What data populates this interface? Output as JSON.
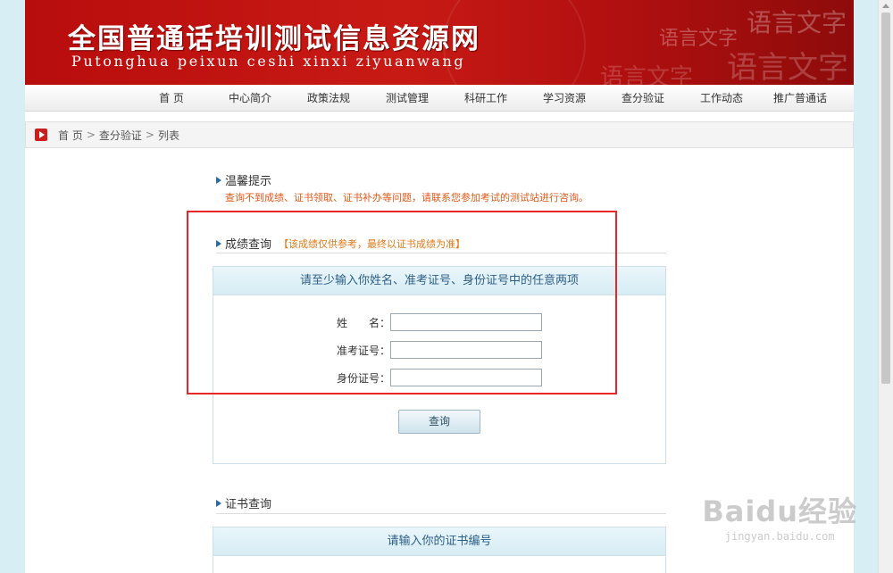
{
  "site": {
    "title_cn": "全国普通话培训测试信息资源网",
    "title_pinyin": "Putonghua peixun ceshi xinxi ziyuanwang",
    "deco_texts": [
      "语言文字",
      "语言文字",
      "语言文字",
      "语言文字"
    ]
  },
  "nav": {
    "items": [
      "首 页",
      "中心简介",
      "政策法规",
      "测试管理",
      "科研工作",
      "学习资源",
      "查分验证",
      "工作动态",
      "推广普通话"
    ]
  },
  "breadcrumb": {
    "items": [
      "首 页",
      "查分验证",
      "列表"
    ],
    "separator": ">"
  },
  "tip": {
    "title": "温馨提示",
    "text": "查询不到成绩、证书领取、证书补办等问题，请联系您参加考试的测试站进行咨询。"
  },
  "score_query": {
    "title": "成绩查询",
    "note": "【该成绩仅供参考，最终以证书成绩为准】",
    "panel_header": "请至少输入你姓名、准考证号、身份证号中的任意两项",
    "fields": [
      {
        "label": "姓　　名：",
        "value": ""
      },
      {
        "label": "准考证号：",
        "value": ""
      },
      {
        "label": "身份证号：",
        "value": ""
      }
    ],
    "submit_label": "查询"
  },
  "cert_query": {
    "title": "证书查询",
    "panel_header": "请输入你的证书编号"
  },
  "watermark": {
    "brand": "Baidu经验",
    "url": "jingyan.baidu.com"
  },
  "colors": {
    "banner_red": "#c81a15",
    "highlight": "#e8262a",
    "tip_orange": "#e05a1a",
    "panel_head_text": "#2d5f86"
  }
}
